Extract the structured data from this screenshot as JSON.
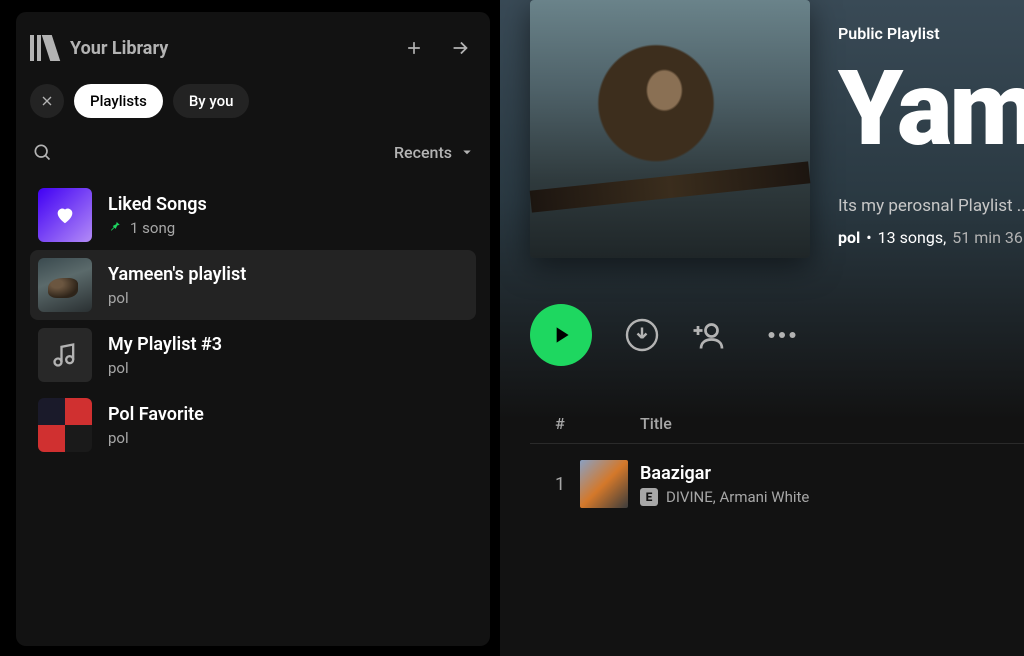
{
  "sidebar": {
    "header": "Your Library",
    "chips": {
      "playlists": "Playlists",
      "byyou": "By you"
    },
    "sort": "Recents",
    "items": [
      {
        "name": "Liked Songs",
        "sub": "1 song",
        "pinned": true
      },
      {
        "name": "Yameen's playlist",
        "sub": "pol"
      },
      {
        "name": "My Playlist #3",
        "sub": "pol"
      },
      {
        "name": "Pol Favorite",
        "sub": "pol"
      }
    ]
  },
  "playlist": {
    "badge": "Public Playlist",
    "title": "Yam",
    "description": "Its my perosnal Playlist ...",
    "owner": "pol",
    "songs_label": "13 songs,",
    "duration": "51 min 36"
  },
  "track_header": {
    "num": "#",
    "title": "Title"
  },
  "tracks": [
    {
      "title": "Baazigar",
      "artists": "DIVINE, Armani White",
      "explicit": "E"
    }
  ]
}
